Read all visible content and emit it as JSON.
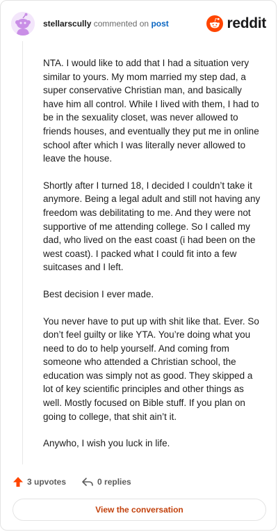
{
  "header": {
    "username": "stellarscully",
    "action_text": "commented on",
    "post_link": "post",
    "brand_name": "reddit",
    "avatar_icon": "snoo-avatar-icon",
    "brand_icon": "reddit-logo-icon"
  },
  "comment": {
    "paragraphs": [
      "NTA. I would like to add that I had a situation very similar to yours. My mom married my step dad, a super conservative Christian man, and basically have him all control. While I lived with them, I had to be in the sexuality closet, was never allowed to friends houses, and eventually they put me in online school after which I was literally never allowed to leave the house.",
      "Shortly after I turned 18, I decided I couldn’t take it anymore. Being a legal adult and still not having any freedom was debilitating to me. And they were not supportive of me attending college. So I called my dad, who lived on the east coast (i had been on the west coast). I packed what I could fit into a few suitcases and I left.",
      "Best decision I ever made.",
      "You never have to put up with shit like that. Ever. So don’t feel guilty or like YTA. You’re doing what you need to do to help yourself. And coming from someone who attended a Christian school, the education was simply not as good. They skipped a lot of key scientific principles and other things as well. Mostly focused on Bible stuff. If you plan on going to college, that shit ain’t it.",
      "Anywho, I wish you luck in life."
    ]
  },
  "actions": {
    "upvotes": "3 upvotes",
    "replies": "0 replies",
    "upvote_icon": "upvote-arrow-icon",
    "reply_icon": "reply-arrow-icon"
  },
  "footer": {
    "view_conversation": "View the conversation"
  },
  "colors": {
    "accent": "#ff4500",
    "link": "#0a66c2",
    "button_text": "#c2410c",
    "avatar_purple": "#c98ee6"
  }
}
